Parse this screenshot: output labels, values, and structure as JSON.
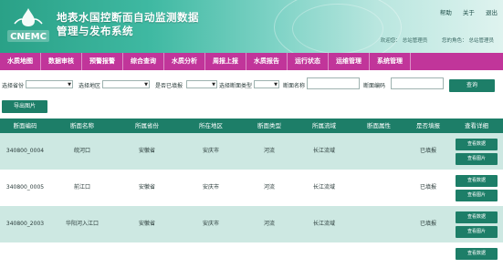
{
  "header": {
    "logo_text": "CNEMC",
    "title_line1": "地表水国控断面自动监测数据",
    "title_line2": "管理与发布系统",
    "links": [
      "帮助",
      "关于",
      "退出"
    ],
    "user_info": [
      "欢迎您：",
      "总站管理员",
      "您的角色：",
      "总站管理员"
    ]
  },
  "nav": {
    "items": [
      "水质地图",
      "数据审核",
      "预警报警",
      "综合查询",
      "水质分析",
      "周报上报",
      "水质报告",
      "运行状态",
      "运维管理",
      "系统管理"
    ]
  },
  "filters": {
    "province_label": "选择省份",
    "city_label": "选择地区",
    "reported_label": "是否已填报",
    "type_label": "选择断面类型",
    "name_label": "断面名称",
    "code_label": "断面编码",
    "query_label": "查询",
    "export_label": "导出图片"
  },
  "table": {
    "headers": [
      "断面编码",
      "断面名称",
      "所属省份",
      "所在地区",
      "断面类型",
      "所属流域",
      "断面属性",
      "是否填报",
      "查看详细"
    ],
    "rows": [
      {
        "code": "340800_0004",
        "name": "皖河口",
        "province": "安徽省",
        "city": "安庆市",
        "type": "河流",
        "basin": "长江流域",
        "attr": "",
        "reported": "已填报"
      },
      {
        "code": "340800_0005",
        "name": "前江口",
        "province": "安徽省",
        "city": "安庆市",
        "type": "河流",
        "basin": "长江流域",
        "attr": "",
        "reported": "已填报"
      },
      {
        "code": "340800_2003",
        "name": "华阳河入江口",
        "province": "安徽省",
        "city": "安庆市",
        "type": "河流",
        "basin": "长江流域",
        "attr": "",
        "reported": "已填报"
      }
    ],
    "action_view": "查看数据",
    "action_image": "查看图片"
  },
  "colors": {
    "nav_bg": "#c1359a",
    "primary": "#1d7e68",
    "row_alt": "#cde8e2"
  }
}
